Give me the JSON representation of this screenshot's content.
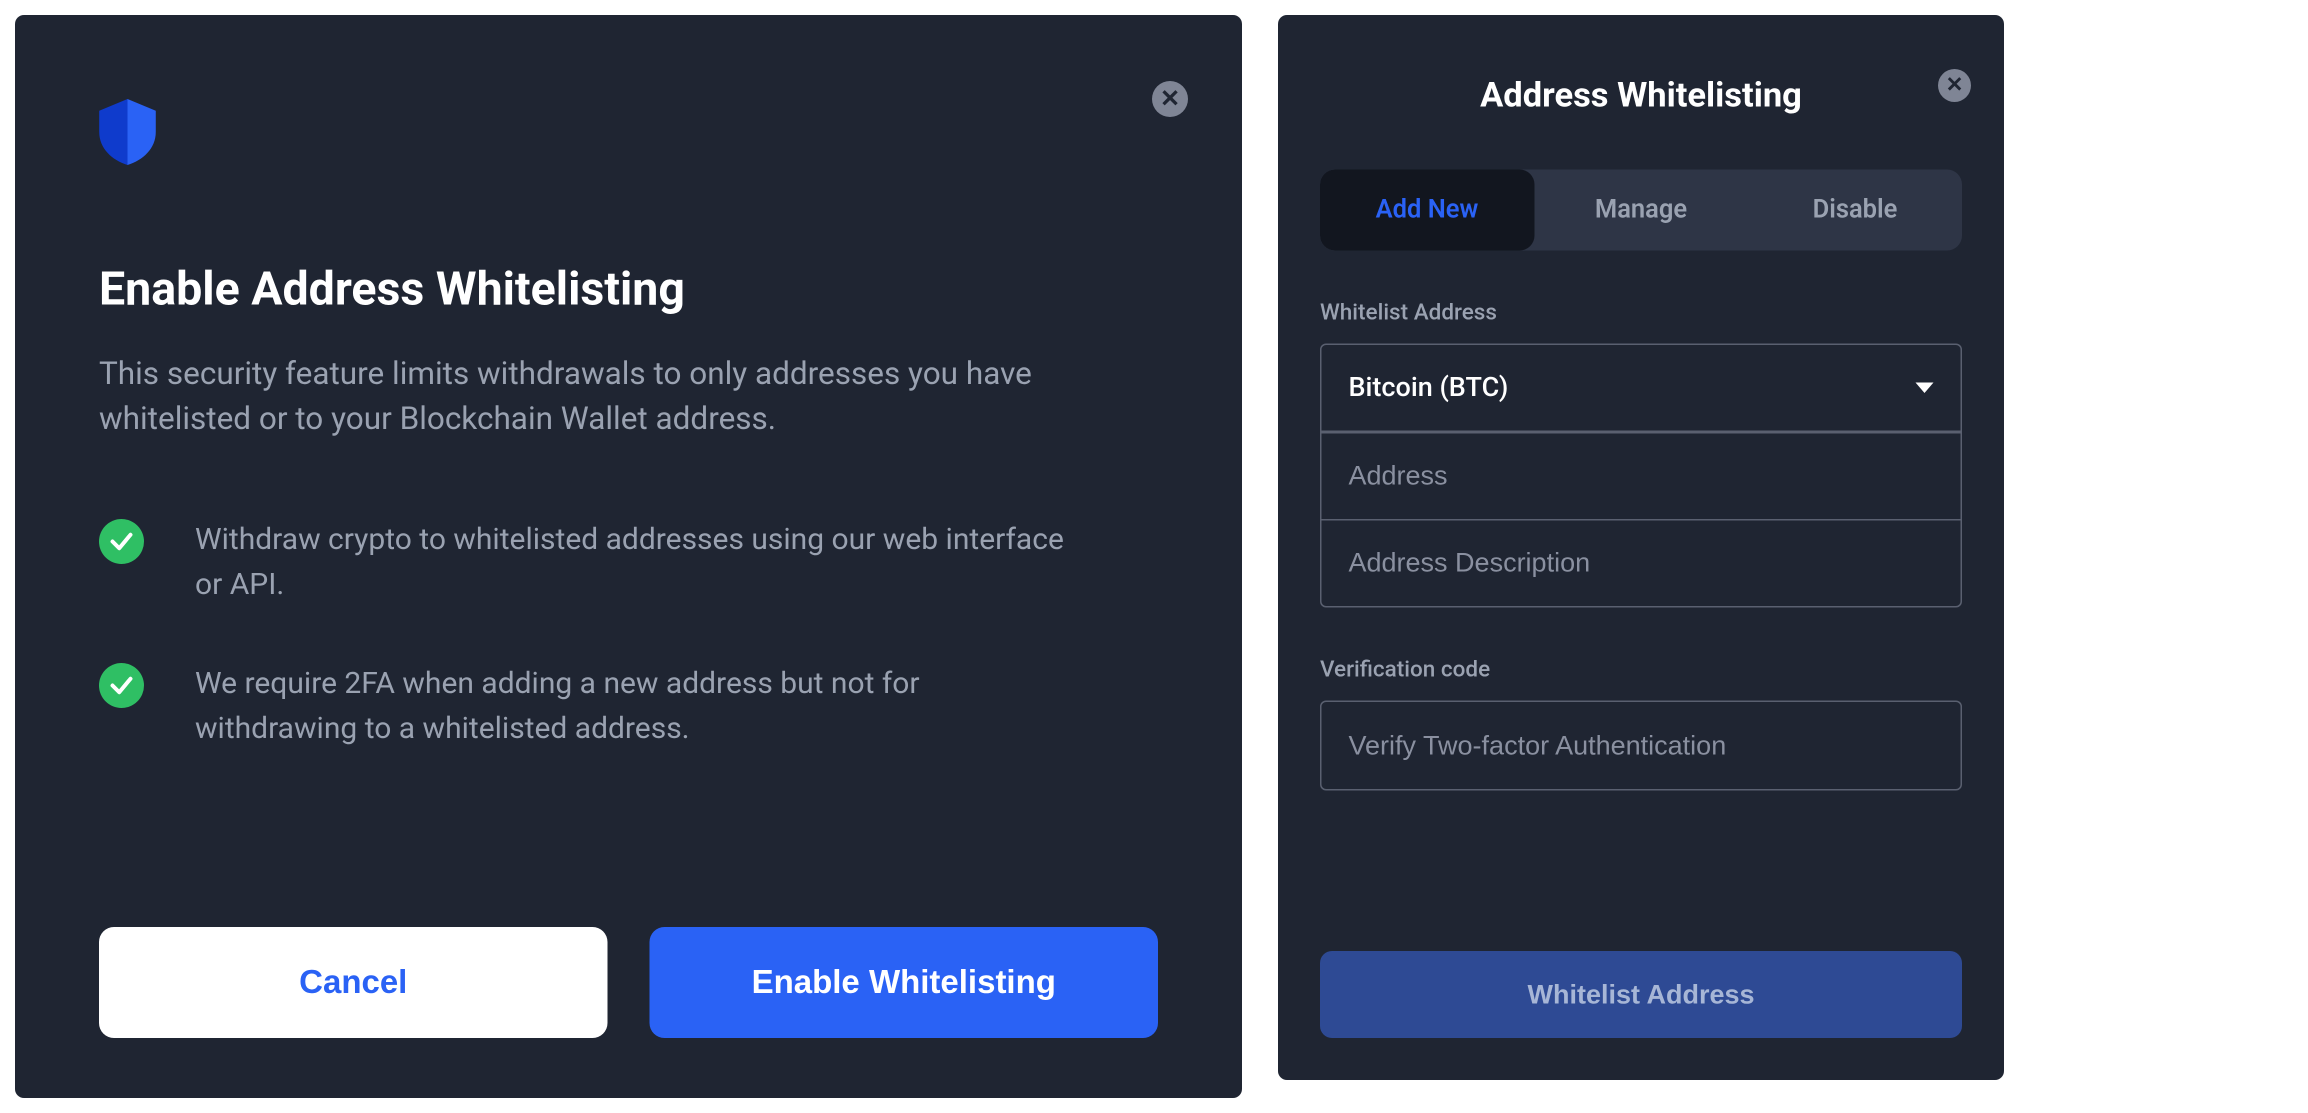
{
  "left": {
    "title": "Enable Address Whitelisting",
    "description": "This security feature limits withdrawals to only addresses you have whitelisted or to your Blockchain Wallet address.",
    "bullets": [
      "Withdraw crypto to whitelisted addresses using our web interface or API.",
      "We require 2FA when adding a new address but not for withdrawing to a whitelisted address."
    ],
    "cancel_label": "Cancel",
    "enable_label": "Enable Whitelisting"
  },
  "right": {
    "title": "Address Whitelisting",
    "tabs": [
      {
        "label": "Add New",
        "active": true
      },
      {
        "label": "Manage",
        "active": false
      },
      {
        "label": "Disable",
        "active": false
      }
    ],
    "whitelist_label": "Whitelist Address",
    "currency_selected": "Bitcoin (BTC)",
    "address_placeholder": "Address",
    "description_placeholder": "Address Description",
    "verification_label": "Verification code",
    "verification_placeholder": "Verify Two-factor Authentication",
    "submit_label": "Whitelist Address"
  }
}
